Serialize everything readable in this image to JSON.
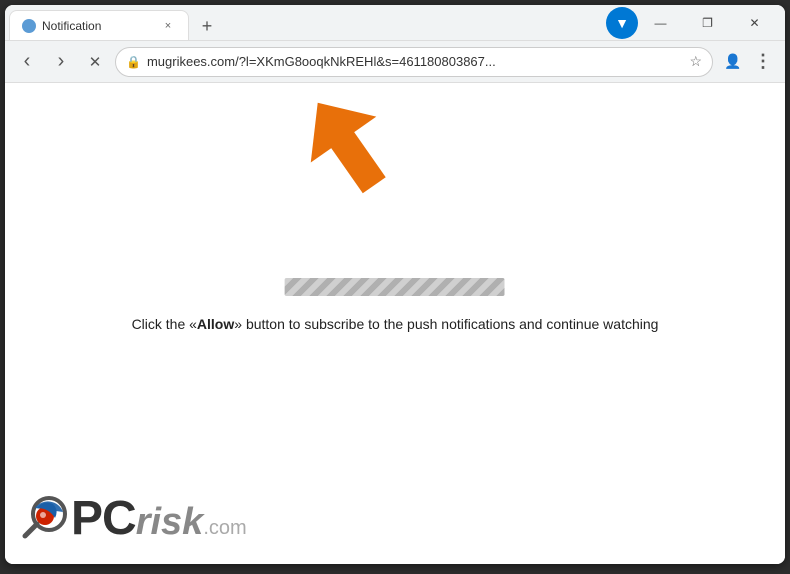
{
  "browser": {
    "title": "Notification",
    "tab": {
      "favicon": "●",
      "title": "Notification",
      "close": "×"
    },
    "new_tab_btn": "+",
    "window_controls": {
      "minimize": "—",
      "restore": "❐",
      "close": "✕"
    },
    "download_icon": "▼",
    "nav": {
      "back": "‹",
      "forward": "›",
      "stop": "✕"
    },
    "address": {
      "lock": "🔒",
      "url": "mugrikees.com/?l=XKmG8ooqkNkREHl&s=461180803867...",
      "star": "☆"
    },
    "toolbar_icons": {
      "profile": "👤",
      "menu": "⋮"
    }
  },
  "page": {
    "arrow_visible": true,
    "progress_bar_visible": true,
    "main_text": "Click the «Allow» button to subscribe to the push notifications and continue watching",
    "allow_label": "Allow",
    "pcrisk": {
      "pc_text": "PC",
      "risk_text": "risk",
      "dot_com": ".com"
    }
  }
}
